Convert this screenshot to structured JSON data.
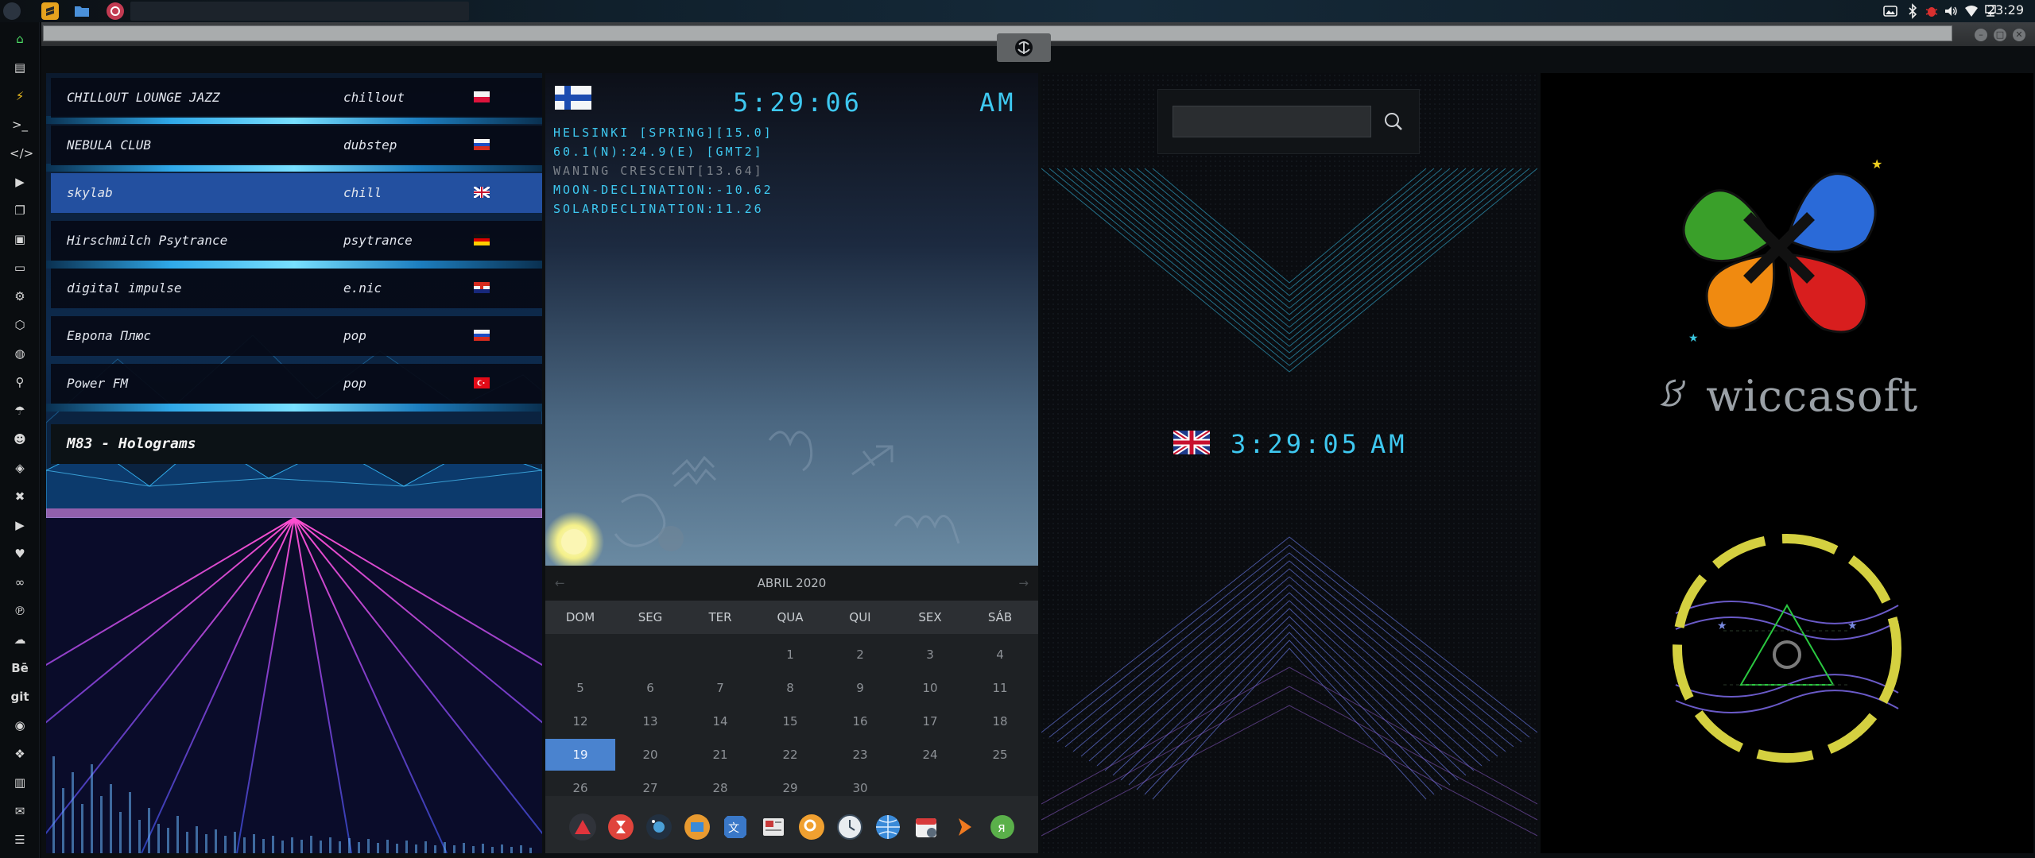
{
  "topbar": {
    "clock": "23:29",
    "tray_icons": [
      "image-icon",
      "bluetooth-icon",
      "bug-icon",
      "volume-icon",
      "wifi-icon",
      "network-icon"
    ]
  },
  "window": {
    "buttons": [
      "minimize-button",
      "maximize-button",
      "close-button"
    ]
  },
  "radio": {
    "stations": [
      {
        "name": "CHILLOUT LOUNGE JAZZ",
        "genre": "chillout",
        "flag": "poland"
      },
      {
        "name": "NEBULA CLUB",
        "genre": "dubstep",
        "flag": "russia"
      },
      {
        "name": "skylab",
        "genre": "chill",
        "flag": "uk",
        "selected": true
      },
      {
        "name": "Hirschmilch Psytrance",
        "genre": "psytrance",
        "flag": "germany"
      },
      {
        "name": "digital impulse",
        "genre": "e.nic",
        "flag": "croatia"
      },
      {
        "name": "Европа Плюс",
        "genre": "pop",
        "flag": "russia"
      },
      {
        "name": "Power FM",
        "genre": "pop",
        "flag": "turkey"
      }
    ],
    "now_playing": "M83 - Holograms"
  },
  "sky_clock": {
    "time": "5:29:06",
    "ampm": "AM",
    "lines": [
      "HELSINKI [SPRING][15.0]",
      "60.1(N):24.9(E) [GMT2]",
      "WANING CRESCENT[13.64]",
      "MOON-DECLINATION:-10.62",
      "SOLARDECLINATION:11.26"
    ]
  },
  "calendar": {
    "month": "ABRIL 2020",
    "prev": "←",
    "next": "→",
    "weekdays": [
      "DOM",
      "SEG",
      "TER",
      "QUA",
      "QUI",
      "SEX",
      "SÁB"
    ],
    "weeks": [
      [
        "",
        "",
        "",
        "1",
        "2",
        "3",
        "4"
      ],
      [
        "5",
        "6",
        "7",
        "8",
        "9",
        "10",
        "11"
      ],
      [
        "12",
        "13",
        "14",
        "15",
        "16",
        "17",
        "18"
      ],
      [
        "19",
        "20",
        "21",
        "22",
        "23",
        "24",
        "25"
      ],
      [
        "26",
        "27",
        "28",
        "29",
        "30",
        "",
        ""
      ]
    ],
    "today": "19"
  },
  "search": {
    "placeholder": ""
  },
  "uk_clock": {
    "time": "3:29:05",
    "ampm": "AM"
  },
  "wiccasoft": {
    "brand": "wiccasoft"
  },
  "colors": {
    "led": "#3ec8f0",
    "calendar_today": "#4a83cf",
    "selected_row": "#2350a0"
  }
}
